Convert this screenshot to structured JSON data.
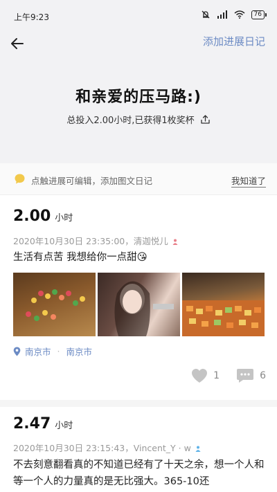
{
  "status_bar": {
    "time": "上午9:23",
    "battery": "76"
  },
  "header": {
    "add_diary_label": "添加进展日记",
    "title": "和亲爱的压马路:)",
    "summary": "总投入2.00小时,已获得1枚奖杯"
  },
  "tip": {
    "text": "点触进展可编辑，添加图文日记",
    "dismiss_label": "我知道了"
  },
  "entries": [
    {
      "hours": "2.00",
      "unit": "小时",
      "meta": "2020年10月30日 23:35:00，清迦悦儿",
      "text": "生活有点苦  我想给你一点甜😘",
      "location": "南京市",
      "location_sub": "南京市",
      "likes": "1",
      "comments": "6"
    },
    {
      "hours": "2.47",
      "unit": "小时",
      "meta": "2020年10月30日 23:15:43，Vincent_Y · w",
      "text": "不去刻意翻看真的不知道已经有了十天之余，想一个人和等一个人的力量真的是无比强大。365-10还"
    }
  ],
  "colors": {
    "accent": "#6c8bc4",
    "header_bg": "#f2f2f4",
    "tip_icon": "#f2c94c"
  }
}
